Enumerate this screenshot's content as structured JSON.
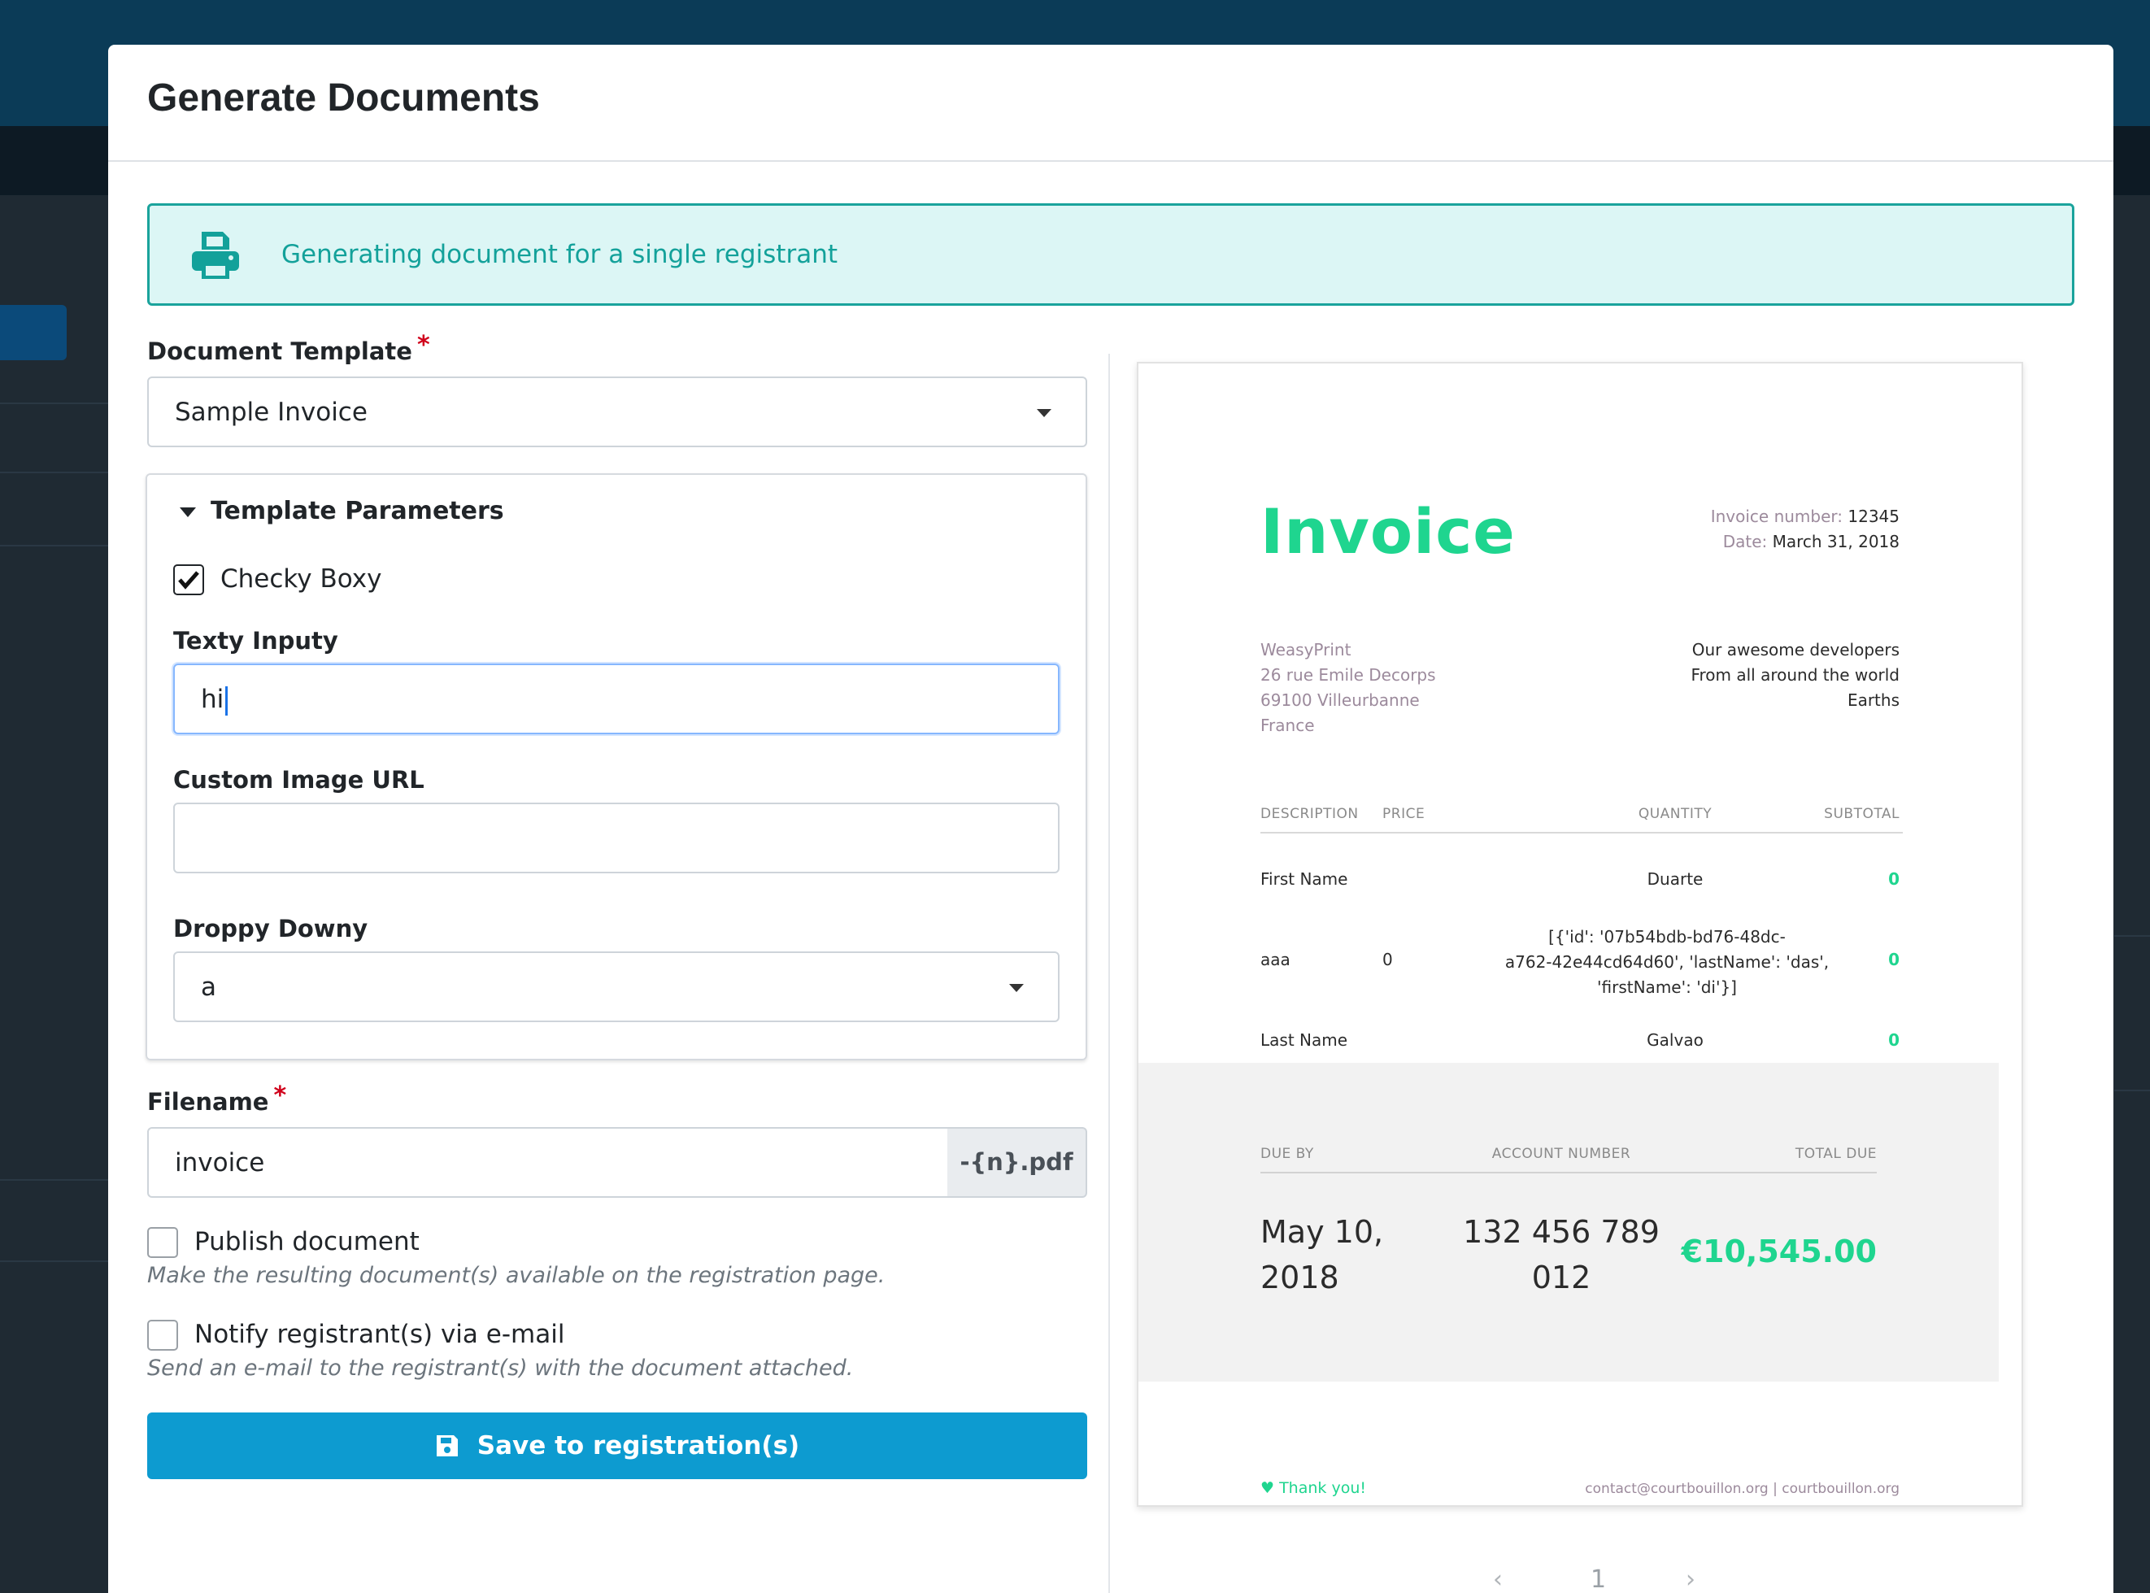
{
  "modal": {
    "title": "Generate Documents",
    "alert_icon": "printer-icon",
    "alert_text": "Generating document for a single registrant"
  },
  "form": {
    "document_template": {
      "label": "Document Template",
      "required_mark": "*",
      "value": "Sample Invoice"
    },
    "template_parameters": {
      "legend": "Template Parameters",
      "checkbox": {
        "label": "Checky Boxy",
        "checked": true
      },
      "text_input": {
        "label": "Texty Inputy",
        "value": "hi"
      },
      "image_url": {
        "label": "Custom Image URL",
        "value": ""
      },
      "dropdown": {
        "label": "Droppy Downy",
        "value": "a"
      }
    },
    "filename": {
      "label": "Filename",
      "required_mark": "*",
      "value": "invoice",
      "suffix": "-{n}.pdf"
    },
    "publish": {
      "label": "Publish document",
      "help": "Make the resulting document(s) available on the registration page.",
      "checked": false
    },
    "notify": {
      "label": "Notify registrant(s) via e-mail",
      "help": "Send an e-mail to the registrant(s) with the document attached.",
      "checked": false
    },
    "save_button": "Save to registration(s)"
  },
  "invoice": {
    "title": "Invoice",
    "number_label": "Invoice number:",
    "number": "12345",
    "date_label": "Date:",
    "date": "March 31, 2018",
    "from": [
      "WeasyPrint",
      "26 rue Emile Decorps",
      "69100 Villeurbanne",
      "France"
    ],
    "to": [
      "Our awesome developers",
      "From all around the world",
      "Earths"
    ],
    "headers": [
      "DESCRIPTION",
      "PRICE",
      "QUANTITY",
      "SUBTOTAL"
    ],
    "rows": [
      {
        "description": "First Name",
        "price": "",
        "quantity": "Duarte",
        "subtotal": "0"
      },
      {
        "description": "aaa",
        "price": "0",
        "quantity": [
          "[{'id': '07b54bdb-bd76-48dc-",
          "a762-42e44cd64d60', 'lastName': 'das',",
          "'firstName': 'di'}]"
        ],
        "subtotal": "0"
      },
      {
        "description": "Last Name",
        "price": "",
        "quantity": "Galvao",
        "subtotal": "0"
      }
    ],
    "due_headers": [
      "DUE BY",
      "ACCOUNT NUMBER",
      "TOTAL DUE"
    ],
    "due_by": [
      "May 10,",
      "2018"
    ],
    "account_number": [
      "132 456 789",
      "012"
    ],
    "total_due": "€10,545.00",
    "thanks": "♥ Thank you!",
    "contact": "contact@courtbouillon.org | courtbouillon.org"
  },
  "pager": {
    "prev": "‹",
    "page": "1",
    "next": "›"
  },
  "colors": {
    "accent": "#0d9bd0",
    "alert_teal": "#13a19a",
    "invoice_green": "#1fd58f"
  }
}
